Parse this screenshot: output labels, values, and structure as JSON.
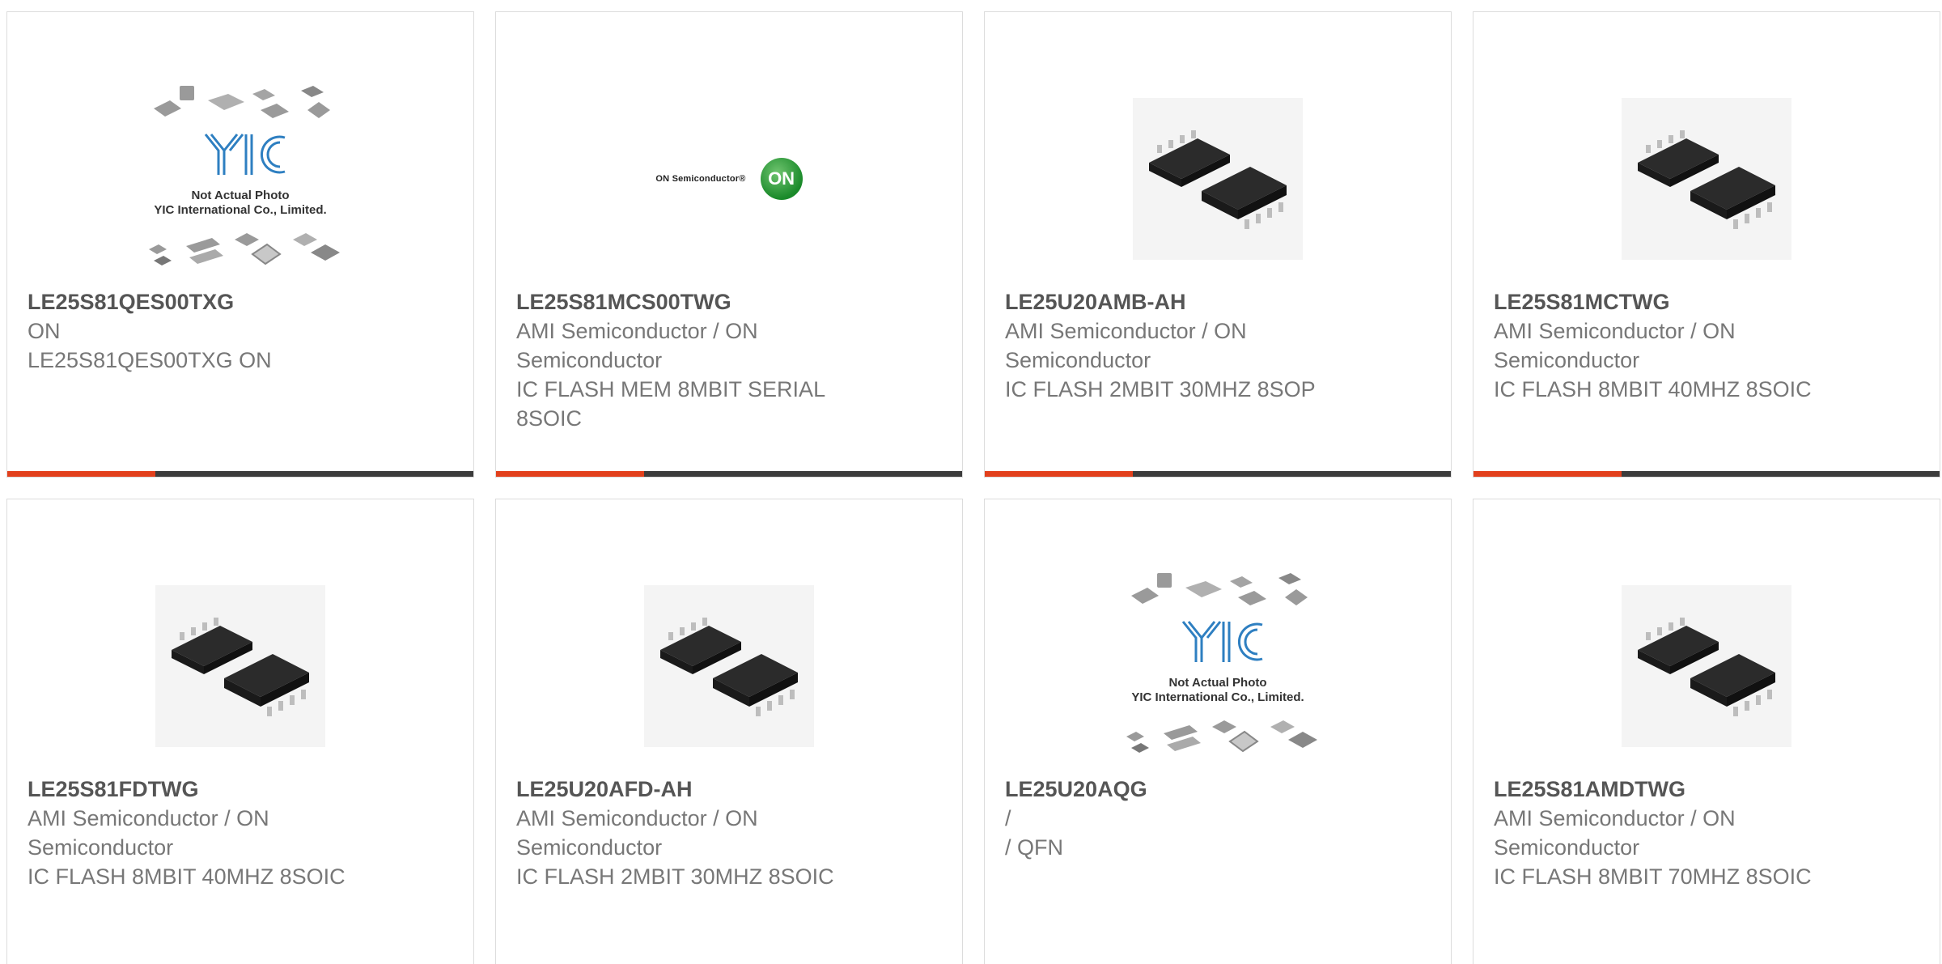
{
  "colors": {
    "accent": "#e2401c",
    "bar": "#3c3c3c",
    "border": "#dcdcdc",
    "text": "#777777",
    "title": "#555555"
  },
  "products": [
    {
      "part_number": "LE25S81QES00TXG",
      "manufacturer": "ON",
      "description": "LE25S81QES00TXG ON",
      "image": "yic-placeholder",
      "image_text": [
        "Not Actual Photo",
        "YIC International Co., Limited."
      ],
      "image_logo": "YIC"
    },
    {
      "part_number": "LE25S81MCS00TWG",
      "manufacturer": "AMI Semiconductor / ON Semiconductor",
      "description": "IC FLASH MEM 8MBIT SERIAL 8SOIC",
      "image": "on-semiconductor-logo",
      "image_text": [
        "ON Semiconductor®"
      ],
      "image_logo": "ON"
    },
    {
      "part_number": "LE25U20AMB-AH",
      "manufacturer": "AMI Semiconductor / ON Semiconductor",
      "description": "IC FLASH 2MBIT 30MHZ 8SOP",
      "image": "soic-chip"
    },
    {
      "part_number": "LE25S81MCTWG",
      "manufacturer": "AMI Semiconductor / ON Semiconductor",
      "description": "IC FLASH 8MBIT 40MHZ 8SOIC",
      "image": "soic-chip"
    },
    {
      "part_number": "LE25S81FDTWG",
      "manufacturer": "AMI Semiconductor / ON Semiconductor",
      "description": "IC FLASH 8MBIT 40MHZ 8SOIC",
      "image": "soic-chip"
    },
    {
      "part_number": "LE25U20AFD-AH",
      "manufacturer": "AMI Semiconductor / ON Semiconductor",
      "description": "IC FLASH 2MBIT 30MHZ 8SOIC",
      "image": "soic-chip"
    },
    {
      "part_number": "LE25U20AQG",
      "manufacturer": "/",
      "description": "/ QFN",
      "image": "yic-placeholder",
      "image_text": [
        "Not Actual Photo",
        "YIC International Co., Limited."
      ],
      "image_logo": "YIC"
    },
    {
      "part_number": "LE25S81AMDTWG",
      "manufacturer": "AMI Semiconductor / ON Semiconductor",
      "description": "IC FLASH 8MBIT 70MHZ 8SOIC",
      "image": "soic-chip"
    }
  ]
}
